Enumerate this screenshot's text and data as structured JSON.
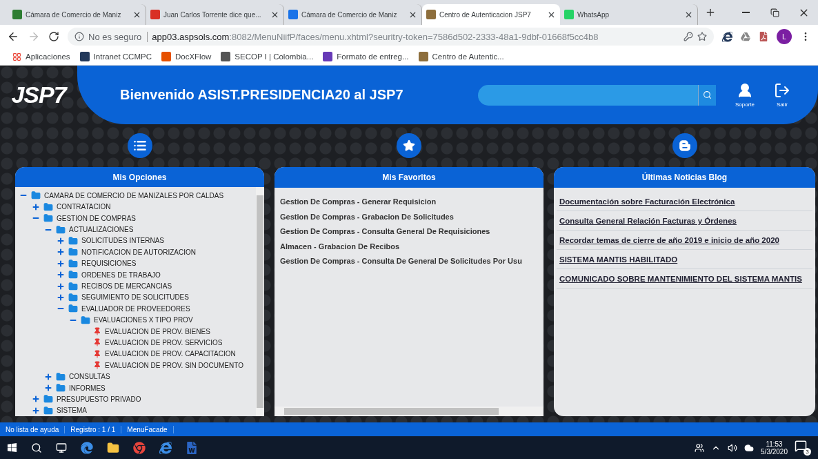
{
  "browser": {
    "tabs": [
      {
        "title": "Cámara de Comercio de Maniz",
        "selected": false
      },
      {
        "title": "Juan Carlos Torrente dice que...",
        "selected": false
      },
      {
        "title": "Cámara de Comercio de Maniz",
        "selected": false
      },
      {
        "title": "Centro de Autenticacion JSP7",
        "selected": true
      },
      {
        "title": "WhatsApp",
        "selected": false
      }
    ],
    "address": {
      "security": "No es seguro",
      "host": "app03.aspsols.com",
      "path": ":8082/MenuNiifP/faces/menu.xhtml?seuritry-token=7586d502-2333-48a1-9dbf-01668f5cc4b8"
    },
    "profile_initial": "L",
    "bookmarks": [
      "Aplicaciones",
      "Intranet CCMPC",
      "DocXFlow",
      "SECOP I | Colombia...",
      "Formato de entreg...",
      "Centro de Autentic..."
    ]
  },
  "app": {
    "logo": "JSP7",
    "welcome": "Bienvenido ASIST.PRESIDENCIA20 al JSP7",
    "actions": [
      "Soporte",
      "Salir"
    ],
    "options": {
      "title": "Mis Opciones",
      "tree": [
        {
          "label": "CAMARA DE COMERCIO DE MANIZALES POR CALDAS",
          "kind": "folder",
          "expanded": true,
          "children": [
            {
              "label": "CONTRATACION",
              "kind": "folder",
              "expanded": false
            },
            {
              "label": "GESTION DE COMPRAS",
              "kind": "folder",
              "expanded": true,
              "children": [
                {
                  "label": "ACTUALIZACIONES",
                  "kind": "folder",
                  "expanded": true,
                  "children": [
                    {
                      "label": "SOLICITUDES INTERNAS",
                      "kind": "folder",
                      "expanded": false
                    },
                    {
                      "label": "NOTIFICACION DE AUTORIZACION",
                      "kind": "folder",
                      "expanded": false
                    },
                    {
                      "label": "REQUISICIONES",
                      "kind": "folder",
                      "expanded": false
                    },
                    {
                      "label": "ORDENES DE TRABAJO",
                      "kind": "folder",
                      "expanded": false
                    },
                    {
                      "label": "RECIBOS DE MERCANCIAS",
                      "kind": "folder",
                      "expanded": false
                    },
                    {
                      "label": "SEGUIMIENTO DE SOLICITUDES",
                      "kind": "folder",
                      "expanded": false
                    },
                    {
                      "label": "EVALUADOR DE PROVEEDORES",
                      "kind": "folder",
                      "expanded": true,
                      "children": [
                        {
                          "label": "EVALUACIONES X TIPO PROV",
                          "kind": "folder",
                          "expanded": true,
                          "children": [
                            {
                              "label": "EVALUACION DE PROV. BIENES",
                              "kind": "item"
                            },
                            {
                              "label": "EVALUACION DE PROV. SERVICIOS",
                              "kind": "item"
                            },
                            {
                              "label": "EVALUACION DE PROV. CAPACITACION",
                              "kind": "item"
                            },
                            {
                              "label": "EVALUACION DE PROV. SIN DOCUMENTO",
                              "kind": "item"
                            }
                          ]
                        }
                      ]
                    }
                  ]
                },
                {
                  "label": "CONSULTAS",
                  "kind": "folder",
                  "expanded": false
                },
                {
                  "label": "INFORMES",
                  "kind": "folder",
                  "expanded": false
                }
              ]
            },
            {
              "label": "PRESUPUESTO PRIVADO",
              "kind": "folder",
              "expanded": false
            },
            {
              "label": "SISTEMA",
              "kind": "folder",
              "expanded": false
            }
          ]
        }
      ]
    },
    "favorites": {
      "title": "Mis Favoritos",
      "items": [
        "Gestion De Compras - Generar Requisicion",
        "Gestion De Compras - Grabacion De Solicitudes",
        "Gestion De Compras - Consulta General De Requisiciones",
        "Almacen - Grabacion De Recibos",
        "Gestion De Compras - Consulta De General De Solicitudes Por Usu"
      ]
    },
    "blog": {
      "title": "Últimas Noticias Blog",
      "links": [
        "Documentación sobre Facturación Electrónica",
        "Consulta General Relación Facturas y Órdenes",
        "Recordar temas de cierre de año 2019 e inicio de año 2020",
        "SISTEMA MANTIS HABILITADO",
        "COMUNICADO SOBRE MANTENIMIENTO DEL SISTEMA MANTIS"
      ]
    },
    "status_bar": [
      "No lista de ayuda",
      "Registro : 1 / 1",
      "MenuFacade"
    ]
  },
  "taskbar": {
    "time": "11:53",
    "date": "5/3/2020",
    "notifications": "3"
  }
}
